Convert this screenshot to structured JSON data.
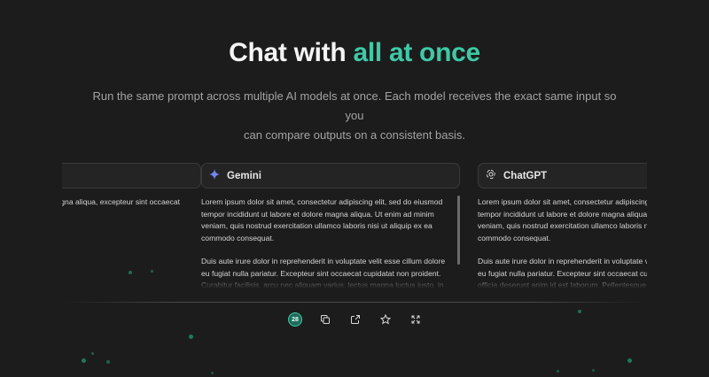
{
  "hero": {
    "title_prefix": "Chat with",
    "title_accent": "all at once",
    "subtitle_line1": "Run the same prompt across multiple AI models at once. Each model receives the exact same input so you",
    "subtitle_line2": "can compare outputs on a consistent basis."
  },
  "cards": {
    "left": {
      "name": "",
      "body": [
        "adipiscing elit, sed do eiusmod gna aliqua, excepteur sint occaecat"
      ]
    },
    "middle": {
      "name": "Gemini",
      "icon": "gemini-sparkle-icon",
      "body": [
        "Lorem ipsum dolor sit amet, consectetur adipiscing elit, sed do eiusmod tempor incididunt ut labore et dolore magna aliqua. Ut enim ad minim veniam, quis nostrud exercitation ullamco laboris nisi ut aliquip ex ea commodo consequat.",
        "Duis aute irure dolor in reprehenderit in voluptate velit esse cillum dolore eu fugiat nulla pariatur. Excepteur sint occaecat cupidatat non proident. Curabitur facilisis, arcu nec aliquam varius, lectus magna luctus justo, in"
      ]
    },
    "right": {
      "name": "ChatGPT",
      "icon": "openai-logo-icon",
      "body": [
        "Lorem ipsum dolor sit amet, consectetur adipiscing elit, sed do eiusmod tempor incididunt ut labore et dolore magna aliqua. Ut enim ad minim veniam, quis nostrud exercitation ullamco laboris nisi ut aliquip ex ea commodo consequat.",
        "Duis aute irure dolor in reprehenderit in voluptate velit esse cillum dolore eu fugiat nulla pariatur. Excepteur sint occaecat cupidatat non proident. officia deserunt anim id est laborum. Pellentesque h"
      ]
    }
  },
  "toolbar": {
    "badge_count": "28",
    "icons": [
      "model-count-badge",
      "copy-icon",
      "open-external-icon",
      "star-icon",
      "expand-icon"
    ]
  },
  "colors": {
    "background": "#1c1c1c",
    "accent": "#3ec9a7",
    "card_border": "#3a3a3a"
  }
}
